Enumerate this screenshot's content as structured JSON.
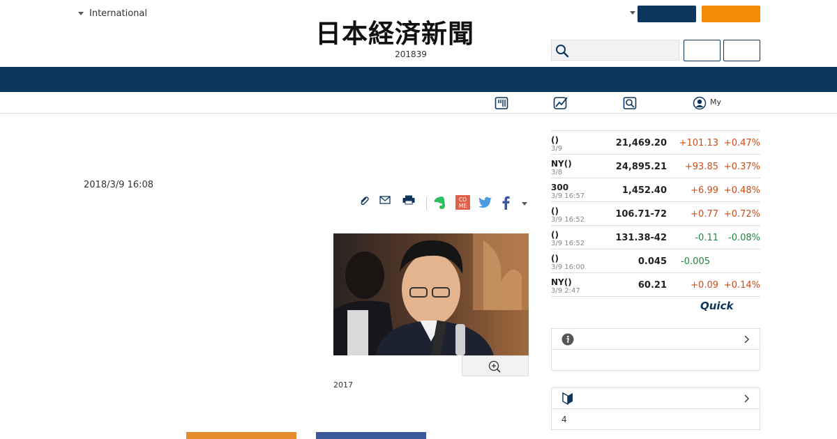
{
  "header": {
    "edition_label": "International",
    "logo_text": "日本経済新聞",
    "date_text": "201839"
  },
  "subnav": {
    "my_label": "My"
  },
  "article": {
    "date": "2018/3/9 16:08",
    "caption": "2017"
  },
  "market": {
    "rows": [
      {
        "name": "()",
        "time": "3/9",
        "value": "21,469.20",
        "change": "+101.13",
        "pct": "+0.47%",
        "dir": "up"
      },
      {
        "name": "NY()",
        "time": "3/8",
        "value": "24,895.21",
        "change": "+93.85",
        "pct": "+0.37%",
        "dir": "up"
      },
      {
        "name": "300",
        "time": "3/9 16:57",
        "value": "1,452.40",
        "change": "+6.99",
        "pct": "+0.48%",
        "dir": "up"
      },
      {
        "name": "()",
        "time": "3/9 16:52",
        "value": "106.71-72",
        "change": "+0.77",
        "pct": "+0.72%",
        "dir": "up"
      },
      {
        "name": "()",
        "time": "3/9 16:52",
        "value": "131.38-42",
        "change": "-0.11",
        "pct": "-0.08%",
        "dir": "down"
      },
      {
        "name": "()",
        "time": "3/9 16:00",
        "value": "0.045",
        "change": "-0.005",
        "pct": "",
        "dir": "down"
      },
      {
        "name": "NY()",
        "time": "3/9 2:47",
        "value": "60.21",
        "change": "+0.09",
        "pct": "+0.14%",
        "dir": "up"
      }
    ],
    "provider": "Quick"
  },
  "boxes": {
    "ranking_count": "4"
  },
  "colors": {
    "navy": "#0d365c",
    "orange": "#f58a07",
    "up": "#d24a12",
    "down": "#1a8a3a"
  }
}
